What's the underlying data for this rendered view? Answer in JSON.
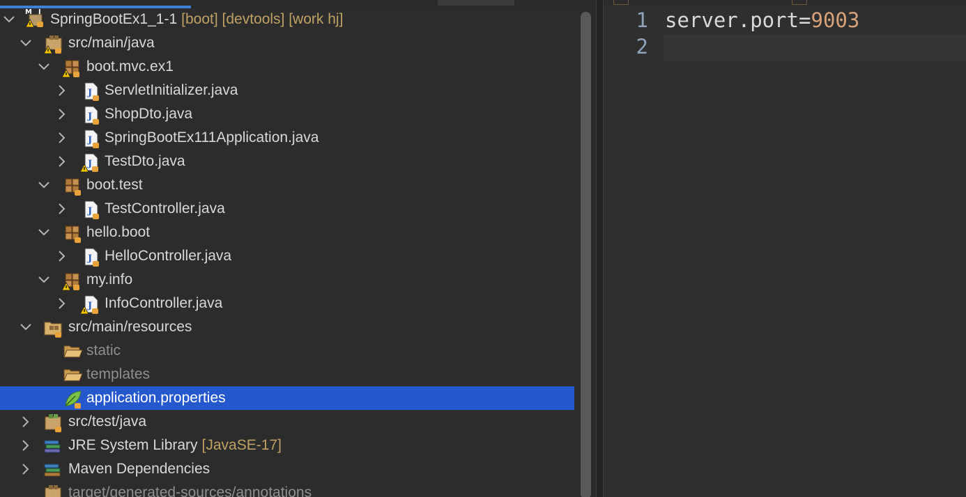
{
  "explorer": {
    "rows": [
      {
        "label": "SpringBootEx1_1-1",
        "decoration": "[boot] [devtools] [work hj]"
      },
      {
        "label": "src/main/java"
      },
      {
        "label": "boot.mvc.ex1"
      },
      {
        "label": "ServletInitializer.java"
      },
      {
        "label": "ShopDto.java"
      },
      {
        "label": "SpringBootEx111Application.java"
      },
      {
        "label": "TestDto.java"
      },
      {
        "label": "boot.test"
      },
      {
        "label": "TestController.java"
      },
      {
        "label": "hello.boot"
      },
      {
        "label": "HelloController.java"
      },
      {
        "label": "my.info"
      },
      {
        "label": "InfoController.java"
      },
      {
        "label": "src/main/resources"
      },
      {
        "label": "static"
      },
      {
        "label": "templates"
      },
      {
        "label": "application.properties",
        "selected": true
      },
      {
        "label": "src/test/java"
      },
      {
        "label": "JRE System Library",
        "decoration": "[JavaSE-17]"
      },
      {
        "label": "Maven Dependencies"
      },
      {
        "label": "target/generated-sources/annotations"
      }
    ]
  },
  "editor": {
    "lines": [
      {
        "number": "1",
        "key": "server.port=",
        "value": "9003"
      },
      {
        "number": "2",
        "key": "",
        "value": ""
      }
    ]
  },
  "colors": {
    "selection": "#2458cc",
    "decoration": "#bfa164",
    "property_value": "#d7a27a",
    "line_number": "#8ea3b8"
  },
  "icons": {
    "project": "maven-project-icon",
    "source_folder": "source-folder-icon",
    "package": "package-icon",
    "java_file": "java-file-icon",
    "folder": "folder-icon",
    "properties_file": "spring-properties-icon",
    "library": "library-icon"
  }
}
